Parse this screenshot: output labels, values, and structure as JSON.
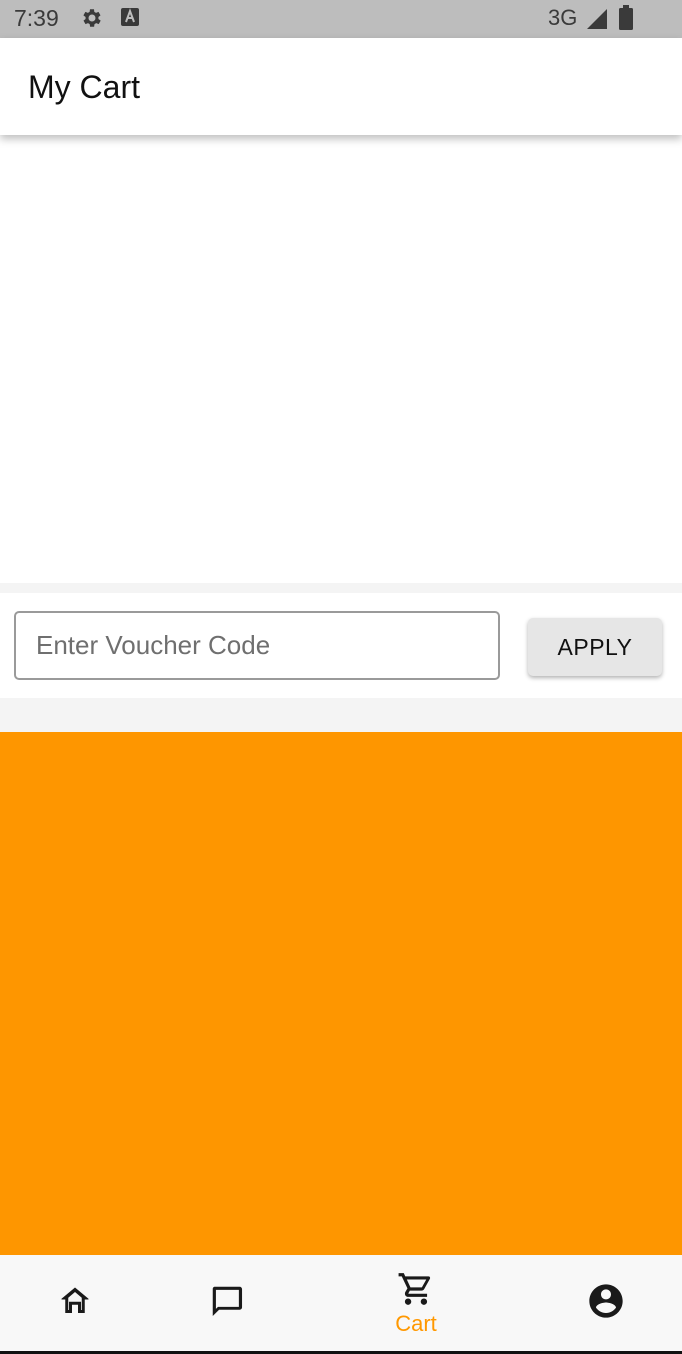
{
  "status_bar": {
    "time": "7:39",
    "left_icons": [
      "gear-icon",
      "keyboard-a-icon"
    ],
    "network_label": "3G",
    "right_icons": [
      "signal-icon",
      "battery-icon"
    ]
  },
  "app_bar": {
    "title": "My Cart"
  },
  "voucher": {
    "placeholder": "Enter Voucher Code",
    "value": "",
    "apply_label": "APPLY"
  },
  "colors": {
    "accent": "#FF9800",
    "panel": "#FE9600",
    "status_bar": "#BDBDBD",
    "nav_inactive": "#1A1A1A"
  },
  "bottom_nav": {
    "items": [
      {
        "icon": "home-icon",
        "label": "",
        "active": false
      },
      {
        "icon": "chat-icon",
        "label": "",
        "active": false
      },
      {
        "icon": "cart-icon",
        "label": "Cart",
        "active": true
      },
      {
        "icon": "account-icon",
        "label": "",
        "active": false
      }
    ]
  }
}
